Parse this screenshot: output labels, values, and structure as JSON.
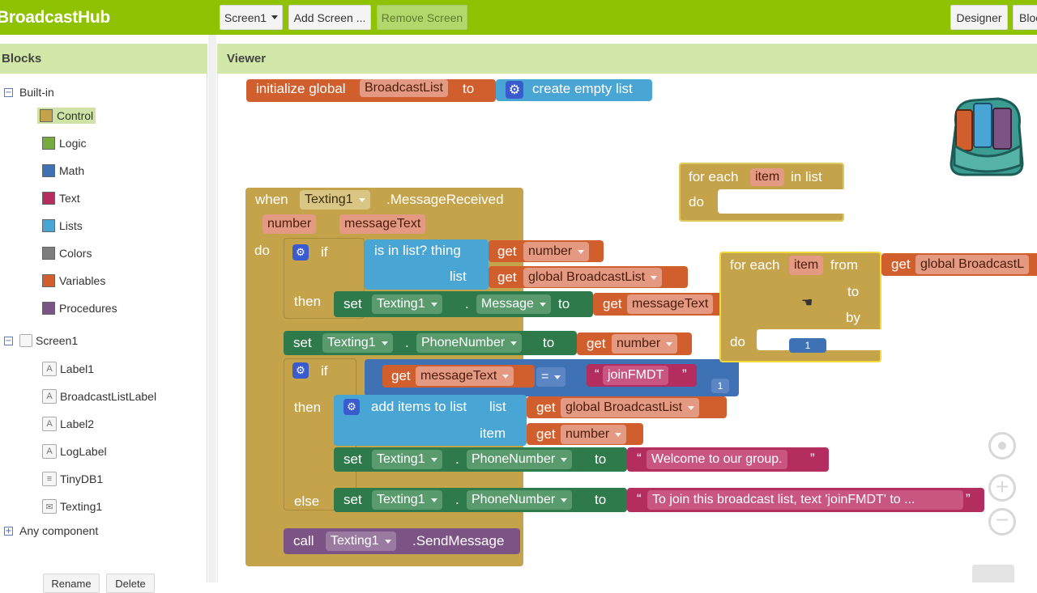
{
  "app": {
    "title": "BroadcastHub"
  },
  "toolbar": {
    "screen_select": "Screen1",
    "add_screen": "Add Screen ...",
    "remove_screen": "Remove Screen",
    "designer": "Designer",
    "blocks": "Blocks"
  },
  "left_panel": {
    "title": "Blocks",
    "builtin_label": "Built-in",
    "builtin_toggle": "−",
    "builtin": [
      {
        "label": "Control",
        "color": "#c4a34a"
      },
      {
        "label": "Logic",
        "color": "#77ab41"
      },
      {
        "label": "Math",
        "color": "#3f71b5"
      },
      {
        "label": "Text",
        "color": "#b32d5e"
      },
      {
        "label": "Lists",
        "color": "#49a6d4"
      },
      {
        "label": "Colors",
        "color": "#7d7d7d"
      },
      {
        "label": "Variables",
        "color": "#d05f2d"
      },
      {
        "label": "Procedures",
        "color": "#7c5385"
      }
    ],
    "screen_label": "Screen1",
    "screen_toggle": "−",
    "components": [
      {
        "label": "Label1",
        "icon": "A"
      },
      {
        "label": "BroadcastListLabel",
        "icon": "A"
      },
      {
        "label": "Label2",
        "icon": "A"
      },
      {
        "label": "LogLabel",
        "icon": "A"
      },
      {
        "label": "TinyDB1",
        "icon": "≡"
      },
      {
        "label": "Texting1",
        "icon": "✉"
      }
    ],
    "any_component": "Any component",
    "any_toggle": "+",
    "rename": "Rename",
    "delete": "Delete"
  },
  "viewer": {
    "title": "Viewer"
  },
  "blocks": {
    "init": {
      "kw": "initialize global",
      "name": "BroadcastList",
      "to": "to",
      "list": "create empty list"
    },
    "event": {
      "when": "when",
      "component": "Texting1",
      "event": ".MessageReceived",
      "p1": "number",
      "p2": "messageText",
      "do": "do"
    },
    "if1": {
      "if": "if",
      "islist": "is in list? thing",
      "list": "list",
      "get": "get",
      "v_number": "number",
      "v_global": "global BroadcastList",
      "then": "then"
    },
    "set1": {
      "set": "set",
      "component": "Texting1",
      "dot": ".",
      "prop": "Message",
      "to": "to",
      "get": "get",
      "val": "messageText"
    },
    "set2": {
      "set": "set",
      "component": "Texting1",
      "dot": ".",
      "prop": "PhoneNumber",
      "to": "to",
      "get": "get",
      "val": "number"
    },
    "if2": {
      "if": "if",
      "get": "get",
      "val": "messageText",
      "eq": "=",
      "str": "joinFMDT",
      "then": "then",
      "else": "else",
      "num": "1"
    },
    "add": {
      "kw": "add items to list",
      "list": "list",
      "get": "get",
      "v_list": "global BroadcastList",
      "item": "item",
      "v_item": "number"
    },
    "set3": {
      "set": "set",
      "component": "Texting1",
      "dot": ".",
      "prop": "PhoneNumber",
      "to": "to",
      "str": "Welcome to our group."
    },
    "set4": {
      "set": "set",
      "component": "Texting1",
      "dot": ".",
      "prop": "PhoneNumber",
      "to": "to",
      "str": "To join this broadcast list, text 'joinFMDT' to ..."
    },
    "call": {
      "call": "call",
      "component": "Texting1",
      "method": ".SendMessage"
    },
    "foreach1": {
      "kw": "for each",
      "var": "item",
      "in": "in list",
      "do": "do"
    },
    "foreach2": {
      "kw": "for each",
      "var": "item",
      "from": "from",
      "get": "get",
      "val": "global BroadcastL",
      "to": "to",
      "by": "by",
      "do": "do",
      "num": "1"
    }
  }
}
